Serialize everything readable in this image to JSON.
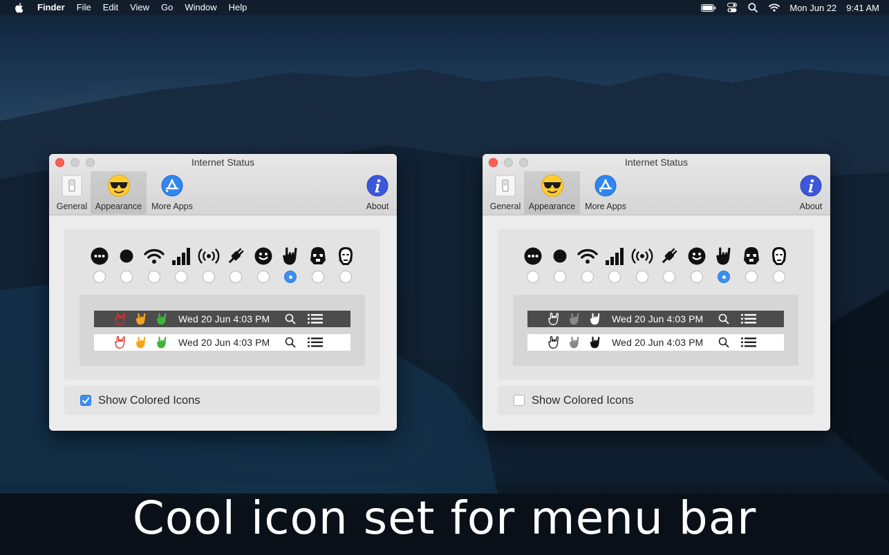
{
  "menubar": {
    "app_name": "Finder",
    "items": [
      "File",
      "Edit",
      "View",
      "Go",
      "Window",
      "Help"
    ],
    "date": "Mon Jun 22",
    "time": "9:41 AM"
  },
  "windows": [
    {
      "title": "Internet Status",
      "tabs": [
        {
          "label": "General",
          "icon": "light-switch-icon"
        },
        {
          "label": "Appearance",
          "icon": "sunglasses-emoji-icon",
          "selected": true
        },
        {
          "label": "More Apps",
          "icon": "app-store-icon"
        },
        {
          "label": "About",
          "icon": "info-icon"
        }
      ],
      "icon_options": [
        "dots-face-icon",
        "dot-icon",
        "wifi-icon",
        "signal-bars-icon",
        "broadcast-icon",
        "plug-icon",
        "smiley-icon",
        "rock-hand-icon",
        "stormtrooper-icon",
        "iron-man-icon"
      ],
      "selected_option_index": 7,
      "preview_text": "Wed 20 Jun  4:03 PM",
      "hand_colors": [
        "#e0302a",
        "#f2a51f",
        "#3db53b"
      ],
      "show_colored_icons": true
    },
    {
      "title": "Internet Status",
      "tabs": [
        {
          "label": "General",
          "icon": "light-switch-icon"
        },
        {
          "label": "Appearance",
          "icon": "sunglasses-emoji-icon",
          "selected": true
        },
        {
          "label": "More Apps",
          "icon": "app-store-icon"
        },
        {
          "label": "About",
          "icon": "info-icon"
        }
      ],
      "icon_options": [
        "dots-face-icon",
        "dot-icon",
        "wifi-icon",
        "signal-bars-icon",
        "broadcast-icon",
        "plug-icon",
        "smiley-icon",
        "rock-hand-icon",
        "stormtrooper-icon",
        "iron-man-icon"
      ],
      "selected_option_index": 7,
      "preview_text": "Wed 20 Jun  4:03 PM",
      "hand_colors_dark": [
        "#ffffff",
        "#8a8a8a",
        "#ffffff"
      ],
      "hand_colors_light": [
        "#222222",
        "#8a8a8a",
        "#111111"
      ],
      "show_colored_icons": false
    }
  ],
  "checkbox_label": "Show Colored Icons",
  "caption": "Cool icon set for menu bar",
  "colors": {
    "accent": "#3b8ff2",
    "close_button": "#fd5f57"
  }
}
